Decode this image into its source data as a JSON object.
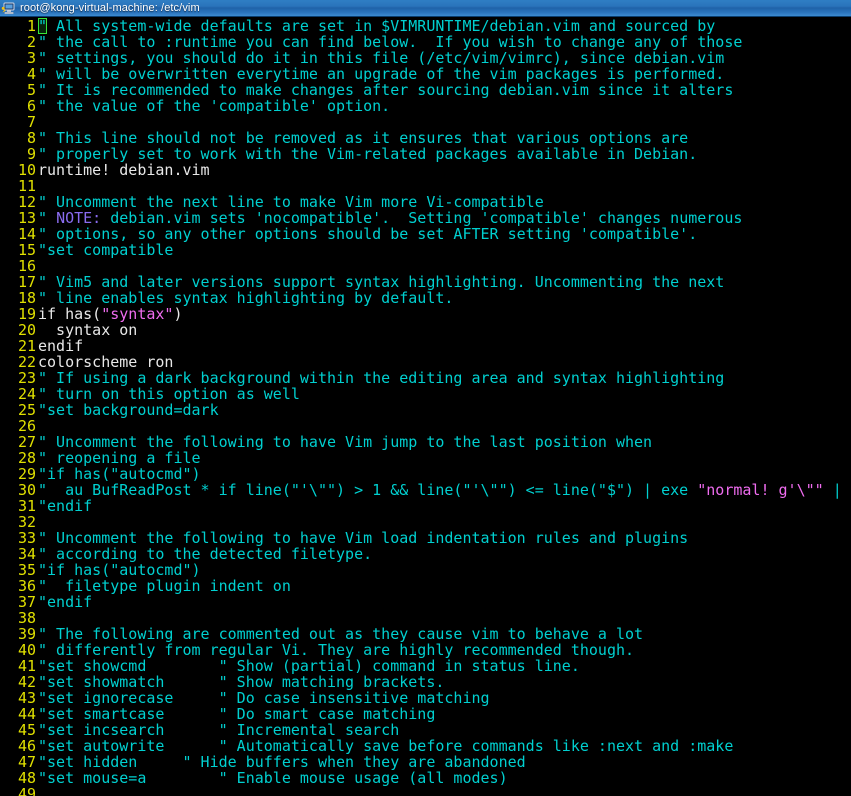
{
  "window": {
    "title": "root@kong-virtual-machine: /etc/vim",
    "icon": "putty-terminal-icon",
    "titlebar_color": "#2a74bb",
    "background_color": "#000000"
  },
  "editor": {
    "app": "vim",
    "file": "/etc/vim/vimrc",
    "line_number_color": "#e0e000",
    "comment_color": "#00d0d0",
    "string_color": "#ef6cef",
    "todo_color": "#8a6cf0",
    "normal_color": "#e8e8e8",
    "cursor": {
      "line": 1,
      "column": 1,
      "color": "#39e639",
      "shape": "block-outline"
    },
    "lines": [
      {
        "n": "1",
        "segments": [
          {
            "t": "\"",
            "c": "cursor"
          },
          {
            "t": " All system-wide defaults are set in $VIMRUNTIME/debian.vim and sourced by",
            "c": "comment"
          }
        ]
      },
      {
        "n": "2",
        "segments": [
          {
            "t": "\" the call to :runtime you can find below.  If you wish to change any of those",
            "c": "comment"
          }
        ]
      },
      {
        "n": "3",
        "segments": [
          {
            "t": "\" settings, you should do it in this file (/etc/vim/vimrc), since debian.vim",
            "c": "comment"
          }
        ]
      },
      {
        "n": "4",
        "segments": [
          {
            "t": "\" will be overwritten everytime an upgrade of the vim packages is performed.",
            "c": "comment"
          }
        ]
      },
      {
        "n": "5",
        "segments": [
          {
            "t": "\" It is recommended to make changes after sourcing debian.vim since it alters",
            "c": "comment"
          }
        ]
      },
      {
        "n": "6",
        "segments": [
          {
            "t": "\" the value of the 'compatible' option.",
            "c": "comment"
          }
        ]
      },
      {
        "n": "7",
        "segments": []
      },
      {
        "n": "8",
        "segments": [
          {
            "t": "\" This line should not be removed as it ensures that various options are",
            "c": "comment"
          }
        ]
      },
      {
        "n": "9",
        "segments": [
          {
            "t": "\" properly set to work with the Vim-related packages available in Debian.",
            "c": "comment"
          }
        ]
      },
      {
        "n": "10",
        "segments": [
          {
            "t": "runtime! debian.vim",
            "c": "normal"
          }
        ]
      },
      {
        "n": "11",
        "segments": []
      },
      {
        "n": "12",
        "segments": [
          {
            "t": "\" Uncomment the next line to make Vim more Vi-compatible",
            "c": "comment"
          }
        ]
      },
      {
        "n": "13",
        "segments": [
          {
            "t": "\" ",
            "c": "comment"
          },
          {
            "t": "NOTE:",
            "c": "todo"
          },
          {
            "t": " debian.vim sets 'nocompatible'.  Setting 'compatible' changes numerous",
            "c": "comment"
          }
        ]
      },
      {
        "n": "14",
        "segments": [
          {
            "t": "\" options, so any other options should be set AFTER setting 'compatible'.",
            "c": "comment"
          }
        ]
      },
      {
        "n": "15",
        "segments": [
          {
            "t": "\"set compatible",
            "c": "comment"
          }
        ]
      },
      {
        "n": "16",
        "segments": []
      },
      {
        "n": "17",
        "segments": [
          {
            "t": "\" Vim5 and later versions support syntax highlighting. Uncommenting the next",
            "c": "comment"
          }
        ]
      },
      {
        "n": "18",
        "segments": [
          {
            "t": "\" line enables syntax highlighting by default.",
            "c": "comment"
          }
        ]
      },
      {
        "n": "19",
        "segments": [
          {
            "t": "if has(",
            "c": "normal"
          },
          {
            "t": "\"syntax\"",
            "c": "string"
          },
          {
            "t": ")",
            "c": "normal"
          }
        ]
      },
      {
        "n": "20",
        "segments": [
          {
            "t": "  syntax on",
            "c": "normal"
          }
        ]
      },
      {
        "n": "21",
        "segments": [
          {
            "t": "endif",
            "c": "normal"
          }
        ]
      },
      {
        "n": "22",
        "segments": [
          {
            "t": "colorscheme ron",
            "c": "normal"
          }
        ]
      },
      {
        "n": "23",
        "segments": [
          {
            "t": "\" If using a dark background within the editing area and syntax highlighting",
            "c": "comment"
          }
        ]
      },
      {
        "n": "24",
        "segments": [
          {
            "t": "\" turn on this option as well",
            "c": "comment"
          }
        ]
      },
      {
        "n": "25",
        "segments": [
          {
            "t": "\"set background=dark",
            "c": "comment"
          }
        ]
      },
      {
        "n": "26",
        "segments": []
      },
      {
        "n": "27",
        "segments": [
          {
            "t": "\" Uncomment the following to have Vim jump to the last position when",
            "c": "comment"
          }
        ]
      },
      {
        "n": "28",
        "segments": [
          {
            "t": "\" reopening a file",
            "c": "comment"
          }
        ]
      },
      {
        "n": "29",
        "segments": [
          {
            "t": "\"if has(\"autocmd\")",
            "c": "comment"
          }
        ]
      },
      {
        "n": "30",
        "segments": [
          {
            "t": "\"  au BufReadPost * if line(\"'\\\"\") > 1 && line(\"'\\\"\") <= line(\"$\") | exe ",
            "c": "comment"
          },
          {
            "t": "\"normal! g'\\\"\"",
            "c": "string"
          },
          {
            "t": " | endif",
            "c": "comment"
          }
        ]
      },
      {
        "n": "31",
        "segments": [
          {
            "t": "\"endif",
            "c": "comment"
          }
        ]
      },
      {
        "n": "32",
        "segments": []
      },
      {
        "n": "33",
        "segments": [
          {
            "t": "\" Uncomment the following to have Vim load indentation rules and plugins",
            "c": "comment"
          }
        ]
      },
      {
        "n": "34",
        "segments": [
          {
            "t": "\" according to the detected filetype.",
            "c": "comment"
          }
        ]
      },
      {
        "n": "35",
        "segments": [
          {
            "t": "\"if has(\"autocmd\")",
            "c": "comment"
          }
        ]
      },
      {
        "n": "36",
        "segments": [
          {
            "t": "\"  filetype plugin indent on",
            "c": "comment"
          }
        ]
      },
      {
        "n": "37",
        "segments": [
          {
            "t": "\"endif",
            "c": "comment"
          }
        ]
      },
      {
        "n": "38",
        "segments": []
      },
      {
        "n": "39",
        "segments": [
          {
            "t": "\" The following are commented out as they cause vim to behave a lot",
            "c": "comment"
          }
        ]
      },
      {
        "n": "40",
        "segments": [
          {
            "t": "\" differently from regular Vi. They are highly recommended though.",
            "c": "comment"
          }
        ]
      },
      {
        "n": "41",
        "segments": [
          {
            "t": "\"set showcmd        \" Show (partial) command in status line.",
            "c": "comment"
          }
        ]
      },
      {
        "n": "42",
        "segments": [
          {
            "t": "\"set showmatch      \" Show matching brackets.",
            "c": "comment"
          }
        ]
      },
      {
        "n": "43",
        "segments": [
          {
            "t": "\"set ignorecase     \" Do case insensitive matching",
            "c": "comment"
          }
        ]
      },
      {
        "n": "44",
        "segments": [
          {
            "t": "\"set smartcase      \" Do smart case matching",
            "c": "comment"
          }
        ]
      },
      {
        "n": "45",
        "segments": [
          {
            "t": "\"set incsearch      \" Incremental search",
            "c": "comment"
          }
        ]
      },
      {
        "n": "46",
        "segments": [
          {
            "t": "\"set autowrite      \" Automatically save before commands like :next and :make",
            "c": "comment"
          }
        ]
      },
      {
        "n": "47",
        "segments": [
          {
            "t": "\"set hidden     \" Hide buffers when they are abandoned",
            "c": "comment"
          }
        ]
      },
      {
        "n": "48",
        "segments": [
          {
            "t": "\"set mouse=a        \" Enable mouse usage (all modes)",
            "c": "comment"
          }
        ]
      },
      {
        "n": "49",
        "segments": []
      }
    ]
  }
}
